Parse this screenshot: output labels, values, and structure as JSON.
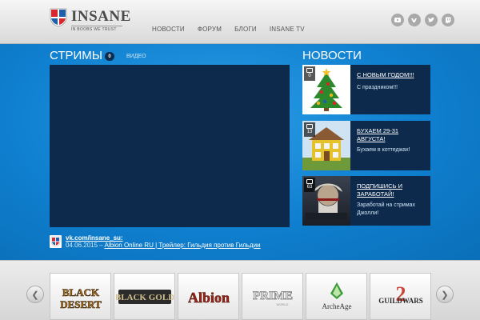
{
  "logo": {
    "name": "INSANE",
    "tagline": "IN BOOBS WE TRUST"
  },
  "nav": [
    {
      "label": "НОВОСТИ"
    },
    {
      "label": "ФОРУМ"
    },
    {
      "label": "БЛОГИ"
    },
    {
      "label": "INSANE TV"
    }
  ],
  "social": [
    "youtube-icon",
    "vk-icon",
    "twitter-icon",
    "twitch-icon"
  ],
  "streams": {
    "title": "СТРИМЫ",
    "count": "0",
    "video_tab": "ВИДЕО"
  },
  "vk": {
    "link": "vk.com/insane_su:",
    "date": "04.06.2015 – ",
    "post": "Albion Online RU | Трейлер: Гильдия против Гильдии"
  },
  "news": {
    "title": "НОВОСТИ",
    "items": [
      {
        "comments": "0",
        "headline": "С НОВЫМ ГОДОМ!!!",
        "desc": "С праздником!!!"
      },
      {
        "comments": "13",
        "headline": "БУХАЕМ 29-31 АВГУСТА!",
        "desc": "Бухаем в коттеджах!"
      },
      {
        "comments": "63",
        "headline": "ПОДПИШИСЬ И ЗАРАБОТАЙ!",
        "desc": "Заработай на стримах Джолли!"
      }
    ]
  },
  "games": [
    {
      "name": "BLACK DESERT",
      "l1": "BLACK",
      "l2": "DESERT"
    },
    {
      "name": "BLACK GOLD",
      "l1": "BLACK GOLD"
    },
    {
      "name": "Albion",
      "l1": "Albion"
    },
    {
      "name": "PRIME WORLD",
      "l1": "PRIME",
      "l2": "WORLD"
    },
    {
      "name": "ArcheAge",
      "l1": "ArcheAge"
    },
    {
      "name": "GUILD WARS 2",
      "l1": "GUILDWARS",
      "l2": "2"
    }
  ],
  "colors": {
    "blue_bg": "#0f7fcf",
    "dark_panel": "#0d2a4d",
    "logo_red": "#d8262e",
    "logo_blue": "#1e5fa8"
  }
}
